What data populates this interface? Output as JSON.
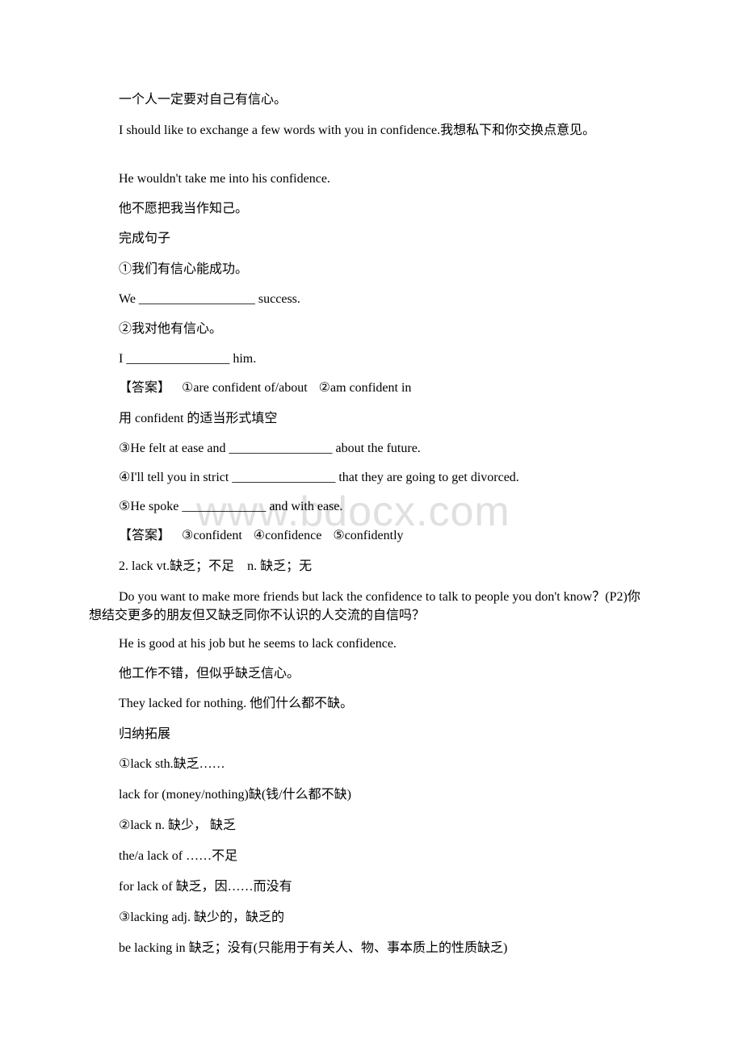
{
  "watermark": "www.bdocx.com",
  "lines": {
    "l1": "一个人一定要对自己有信心。",
    "l2": "I should like to exchange a few words with you in confidence.我想私下和你交换点意见。",
    "l3": "He wouldn't take me into his confidence.",
    "l4": "他不愿把我当作知己。",
    "l5": "完成句子",
    "l6": "①我们有信心能成功。",
    "l7": "We __________________ success.",
    "l8": "②我对他有信心。",
    "l9": "I ________________ him.",
    "l10_label": "【答案】",
    "l10_a1": "①are confident of/about",
    "l10_a2": "②am confident in",
    "l11": "用 confident 的适当形式填空",
    "l12": "③He felt at ease and ________________ about the future.",
    "l13": "④I'll tell you in strict ________________ that they are going to get divorced.",
    "l14": "⑤He spoke _____________ and with ease.",
    "l15_label": "【答案】",
    "l15_a3": "③confident",
    "l15_a4": "④confidence",
    "l15_a5": "⑤confidently",
    "l16": "2. lack vt.缺乏；不足　n. 缺乏；无",
    "l17": "Do you want to make more friends but lack the confidence to talk to people you don't know？(P2)你想结交更多的朋友但又缺乏同你不认识的人交流的自信吗？",
    "l18": "He is good at his job but he seems to lack confidence.",
    "l19": "他工作不错，但似乎缺乏信心。",
    "l20": "They lacked for nothing. 他们什么都不缺。",
    "l21": "归纳拓展",
    "l22": "①lack sth.缺乏……",
    "l23": "lack for (money/nothing)缺(钱/什么都不缺)",
    "l24": "②lack n. 缺少， 缺乏",
    "l25": "the/a lack of ……不足",
    "l26": "for lack of 缺乏，因……而没有",
    "l27": "③lacking adj. 缺少的，缺乏的",
    "l28": "be lacking in 缺乏；没有(只能用于有关人、物、事本质上的性质缺乏)"
  }
}
